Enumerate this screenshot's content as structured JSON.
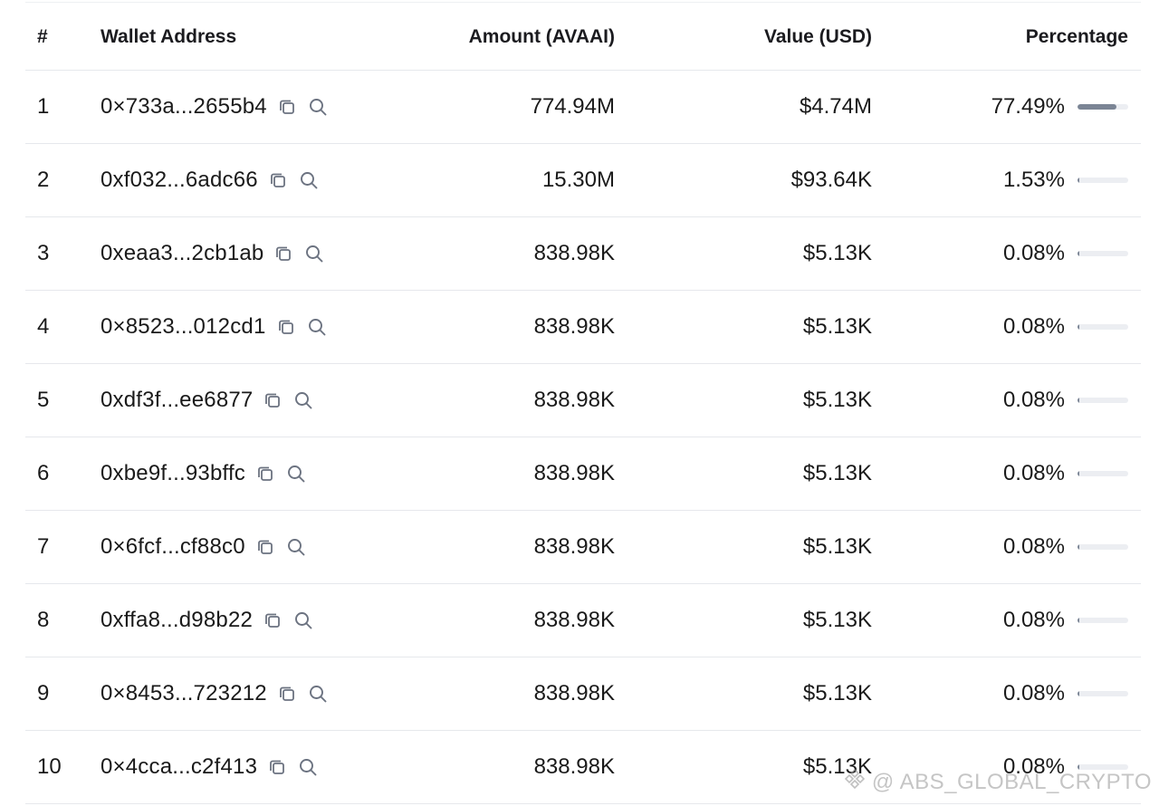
{
  "table": {
    "headers": {
      "rank": "#",
      "address": "Wallet Address",
      "amount": "Amount (AVAAI)",
      "value": "Value (USD)",
      "percentage": "Percentage"
    },
    "rows": [
      {
        "rank": "1",
        "address": "0×733a...2655b4",
        "amount": "774.94M",
        "value": "$4.74M",
        "percentage": "77.49%",
        "share": 0.7749
      },
      {
        "rank": "2",
        "address": "0xf032...6adc66",
        "amount": "15.30M",
        "value": "$93.64K",
        "percentage": "1.53%",
        "share": 0.0153
      },
      {
        "rank": "3",
        "address": "0xeaa3...2cb1ab",
        "amount": "838.98K",
        "value": "$5.13K",
        "percentage": "0.08%",
        "share": 0.0008
      },
      {
        "rank": "4",
        "address": "0×8523...012cd1",
        "amount": "838.98K",
        "value": "$5.13K",
        "percentage": "0.08%",
        "share": 0.0008
      },
      {
        "rank": "5",
        "address": "0xdf3f...ee6877",
        "amount": "838.98K",
        "value": "$5.13K",
        "percentage": "0.08%",
        "share": 0.0008
      },
      {
        "rank": "6",
        "address": "0xbe9f...93bffc",
        "amount": "838.98K",
        "value": "$5.13K",
        "percentage": "0.08%",
        "share": 0.0008
      },
      {
        "rank": "7",
        "address": "0×6fcf...cf88c0",
        "amount": "838.98K",
        "value": "$5.13K",
        "percentage": "0.08%",
        "share": 0.0008
      },
      {
        "rank": "8",
        "address": "0xffa8...d98b22",
        "amount": "838.98K",
        "value": "$5.13K",
        "percentage": "0.08%",
        "share": 0.0008
      },
      {
        "rank": "9",
        "address": "0×8453...723212",
        "amount": "838.98K",
        "value": "$5.13K",
        "percentage": "0.08%",
        "share": 0.0008
      },
      {
        "rank": "10",
        "address": "0×4cca...c2f413",
        "amount": "838.98K",
        "value": "$5.13K",
        "percentage": "0.08%",
        "share": 0.0008
      }
    ],
    "row_icons": [
      "copy-icon",
      "search-icon"
    ]
  },
  "colors": {
    "bar_fill": "#7b8595",
    "bar_track": "#eceef2",
    "divider": "#e6e8ec"
  },
  "watermark": {
    "text": "@ ABS_GLOBAL_CRYPTO"
  }
}
